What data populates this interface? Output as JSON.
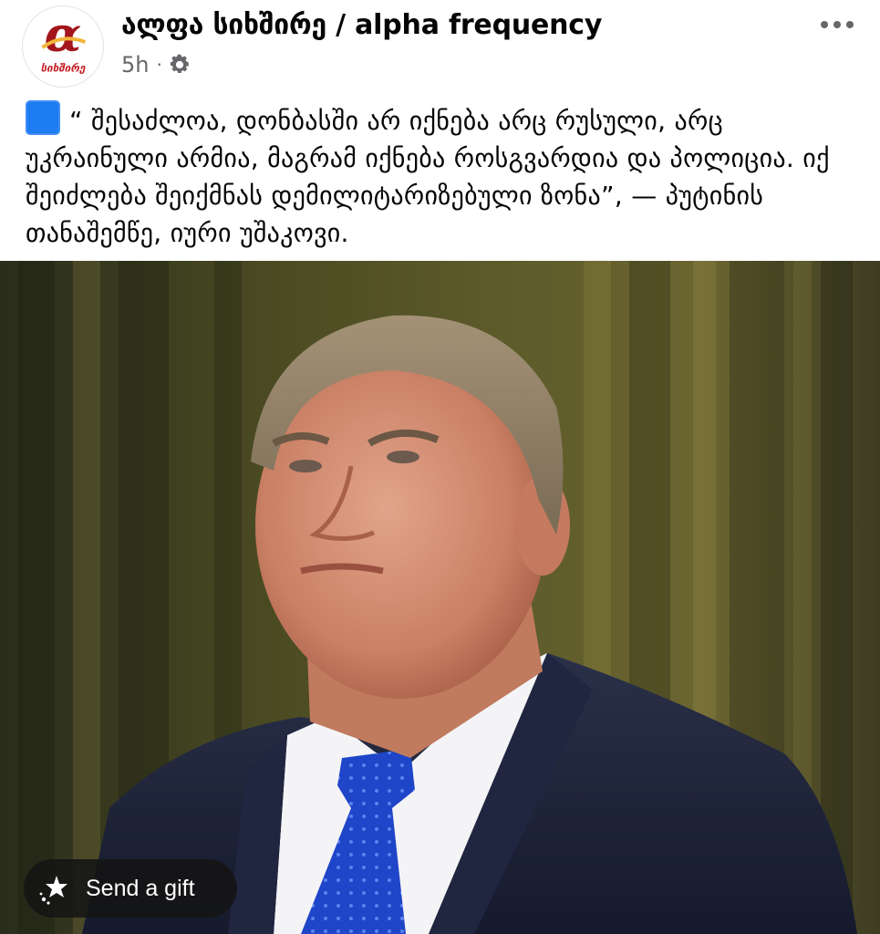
{
  "post": {
    "page_name": "ალფა სიხშირე / alpha frequency",
    "time": "5h",
    "separator": "·",
    "audience_icon": "gear-icon",
    "more_icon": "more-horizontal-icon",
    "avatar": {
      "logo_text": "სიხშირე",
      "logo_letter": "α",
      "brand_color": "#a3161c",
      "accent_color": "#f2b53a"
    },
    "body": {
      "emoji": "blue-square-icon",
      "text": "“ შესაძლოა, დონბასში არ იქნება არც რუსული, არც უკრაინული არმია, მაგრამ იქნება როსგვარდია და პოლიცია. იქ შეიძლება შეიქმნას დემილიტარიზებული ზონა”, — პუტინის თანაშემწე, იური უშაკოვი."
    },
    "photo": {
      "subject": "portrait-photo"
    },
    "gift_button": {
      "label": "Send a gift",
      "icon": "gift-sparkle-icon"
    }
  },
  "colors": {
    "text_primary": "#050505",
    "text_secondary": "#65676b",
    "blue_square": "#1d7cf2",
    "gift_bg": "#141414"
  }
}
